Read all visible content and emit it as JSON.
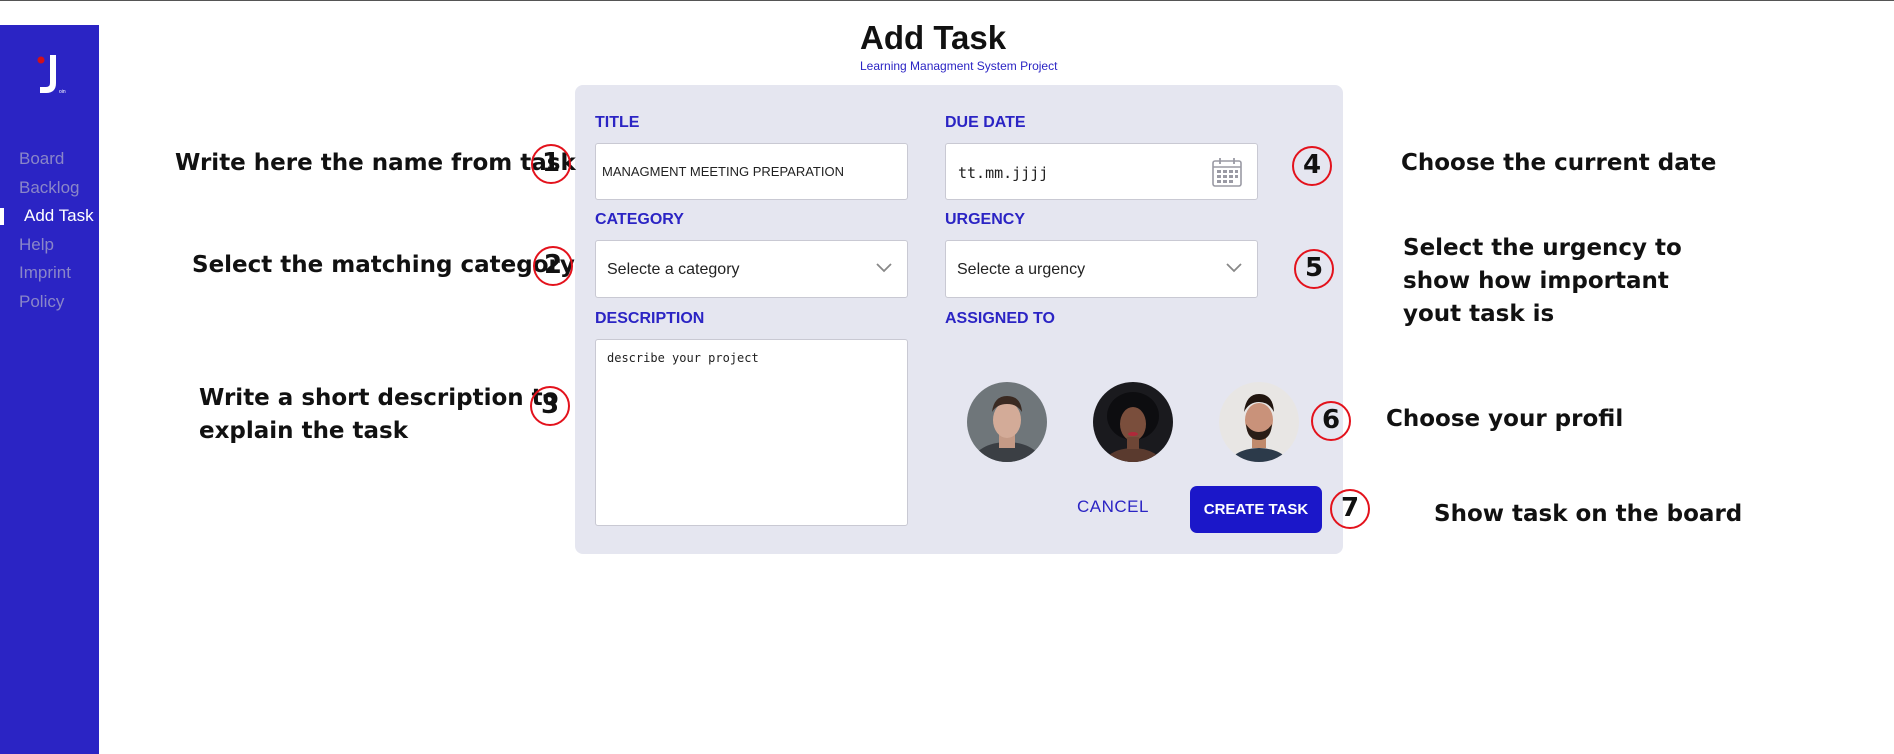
{
  "sidebar": {
    "logo_letter": "J",
    "logo_small": "oin",
    "items": [
      {
        "label": "Board"
      },
      {
        "label": "Backlog"
      },
      {
        "label": "Add Task"
      },
      {
        "label": "Help"
      },
      {
        "label": "Imprint"
      },
      {
        "label": "Policy"
      }
    ],
    "active_index": 2
  },
  "header": {
    "title": "Add Task",
    "subtitle": "Learning Managment System Project"
  },
  "form": {
    "title_label": "TITLE",
    "title_value": "MANAGMENT MEETING PREPARATION",
    "due_date_label": "DUE DATE",
    "due_date_placeholder": "tt.mm.jjjj",
    "category_label": "CATEGORY",
    "category_value": "Selecte a category",
    "urgency_label": "URGENCY",
    "urgency_value": "Selecte a urgency",
    "description_label": "DESCRIPTION",
    "description_placeholder": "describe your project",
    "assigned_label": "ASSIGNED TO",
    "cancel_label": "CANCEL",
    "create_label": "CREATE TASK"
  },
  "annotations": [
    {
      "num": "1",
      "text": "Write here the name from task"
    },
    {
      "num": "2",
      "text": "Select the matching category"
    },
    {
      "num": "3",
      "text_line1": "Write a short description to",
      "text_line2": "explain the task"
    },
    {
      "num": "4",
      "text": "Choose the current date"
    },
    {
      "num": "5",
      "text_line1": "Select the urgency to",
      "text_line2": "show how important",
      "text_line3": "yout task is"
    },
    {
      "num": "6",
      "text": "Choose your profil"
    },
    {
      "num": "7",
      "text": "Show task on the board"
    }
  ],
  "colors": {
    "sidebar": "#2b24c4",
    "accent": "#2b24c4",
    "card": "#e5e6f0",
    "button": "#1b17c9",
    "marker": "#e3121c"
  }
}
